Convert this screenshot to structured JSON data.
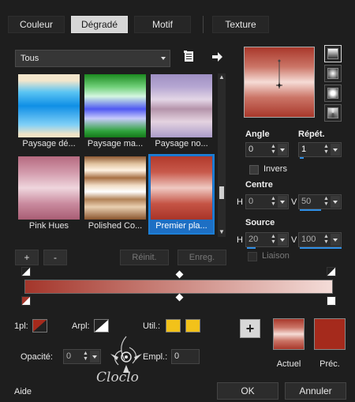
{
  "tabs": [
    {
      "label": "Couleur"
    },
    {
      "label": "Dégradé"
    },
    {
      "label": "Motif"
    },
    {
      "label": "Texture"
    }
  ],
  "library": {
    "dropdown_value": "Tous",
    "thumbnails": [
      {
        "caption": "Paysage dé..."
      },
      {
        "caption": "Paysage ma..."
      },
      {
        "caption": "Paysage no..."
      },
      {
        "caption": "Pink Hues"
      },
      {
        "caption": "Polished Co..."
      },
      {
        "caption": "Premier pla..."
      }
    ],
    "add_label": "+",
    "remove_label": "-",
    "reset_label": "Réinit.",
    "save_label": "Enreg."
  },
  "controls": {
    "angle_label": "Angle",
    "angle_value": "0",
    "repeat_label": "Répét.",
    "repeat_value": "1",
    "invert_label": "Invers",
    "center_label": "Centre",
    "h_label": "H",
    "v_label": "V",
    "center_h": "0",
    "center_v": "50",
    "source_label": "Source",
    "source_h": "20",
    "source_v": "100",
    "link_label": "Liaison"
  },
  "bottom": {
    "opacity_1pl_label": "1pl:",
    "arpl_label": "Arpl:",
    "util_label": "Util.:",
    "opacity_label": "Opacité:",
    "opacity_value": "0",
    "empl_label": "Empl.:",
    "empl_value": "0",
    "current_label": "Actuel",
    "previous_label": "Préc.",
    "help_label": "Aide",
    "ok_label": "OK",
    "cancel_label": "Annuler",
    "watermark_text": "Cloclo"
  },
  "colors": {
    "accent": "#1d7fd6",
    "gradient_dark": "#a4362b",
    "gradient_light": "#f4dcd8",
    "util_yellow": "#f2c21a",
    "prev_swatch": "#a52a1c"
  }
}
